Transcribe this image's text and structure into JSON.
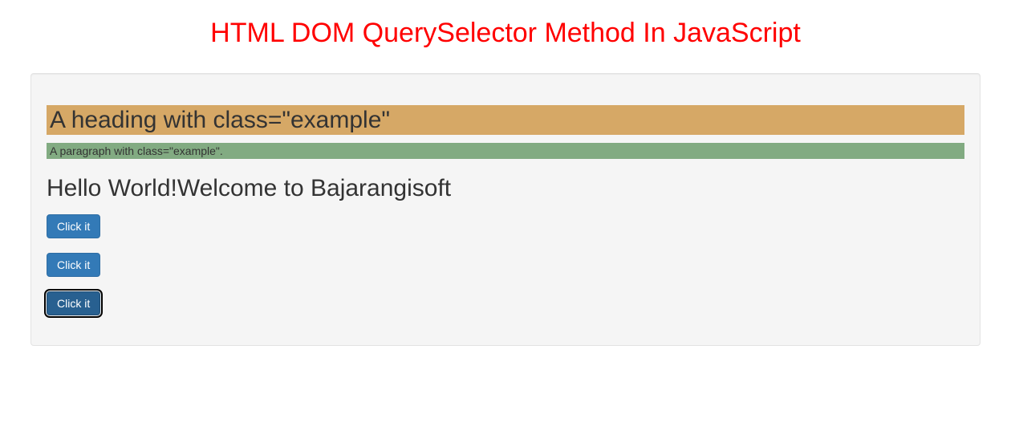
{
  "title": "HTML DOM QuerySelector Method In JavaScript",
  "example_heading": "A heading with class=\"example\"",
  "example_paragraph": "A paragraph with class=\"example\".",
  "sub_heading": "Hello World!Welcome to Bajarangisoft",
  "buttons": {
    "btn1": "Click it",
    "btn2": "Click it",
    "btn3": "Click it"
  }
}
